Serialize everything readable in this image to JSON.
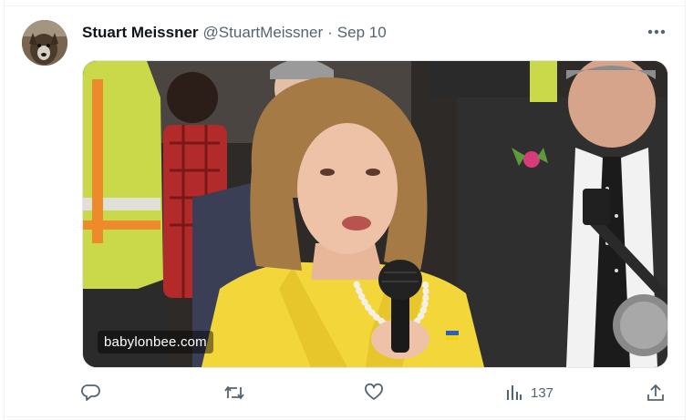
{
  "tweet": {
    "author_name": "Stuart Meissner",
    "author_handle": "@StuartMeissner",
    "separator": "·",
    "date": "Sep 10",
    "media": {
      "watermark": "babylonbee.com"
    },
    "actions": {
      "reply_icon": "reply-icon",
      "retweet_icon": "retweet-icon",
      "like_icon": "heart-icon",
      "views_icon": "bar-chart-icon",
      "views_count": "137",
      "share_icon": "share-icon"
    }
  },
  "colors": {
    "text_primary": "#0f1419",
    "text_secondary": "#536471",
    "border": "#eff3f4",
    "jacket_yellow": "#f3d63a",
    "vest_yellow": "#d6e84a"
  }
}
